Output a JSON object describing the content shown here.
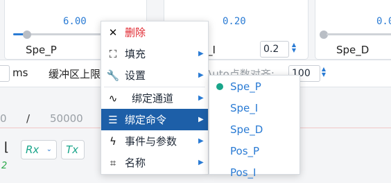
{
  "panels": {
    "p1": {
      "value": "6.00",
      "label": "Spe_P"
    },
    "p2": {
      "value": "0.20",
      "label": "_I",
      "spin_value": "0.2"
    },
    "p3": {
      "value": "0.0",
      "label": "Spe_D"
    }
  },
  "row": {
    "ms_label": "ms",
    "buffer_label": "缓冲区上限",
    "auto_label": "Auto点数对齐:",
    "auto_value": "100"
  },
  "counter": {
    "left": "0",
    "sep": "/",
    "total": "50000"
  },
  "tools": {
    "rx_label": "Rx",
    "tx_label": "Tx",
    "bottom_char": "2"
  },
  "context_menu": {
    "items": [
      {
        "label": "删除",
        "icon": "close-icon"
      },
      {
        "label": "填充",
        "icon": "fill-icon"
      },
      {
        "label": "设置",
        "icon": "wrench-icon"
      },
      {
        "label": "绑定通道",
        "icon": "waveform-icon"
      },
      {
        "label": "绑定命令",
        "icon": "list-icon"
      },
      {
        "label": "事件与参数",
        "icon": "lightning-icon"
      },
      {
        "label": "名称",
        "icon": "tag-icon"
      }
    ]
  },
  "submenu": {
    "items": [
      "Spe_P",
      "Spe_I",
      "Spe_D",
      "Pos_P",
      "Pos_I"
    ],
    "selected_index": 0
  },
  "colors": {
    "accent": "#2a7bd4",
    "menu_selected": "#1d5fa8",
    "delete_red": "#e0262e",
    "teal": "#19a58a"
  }
}
